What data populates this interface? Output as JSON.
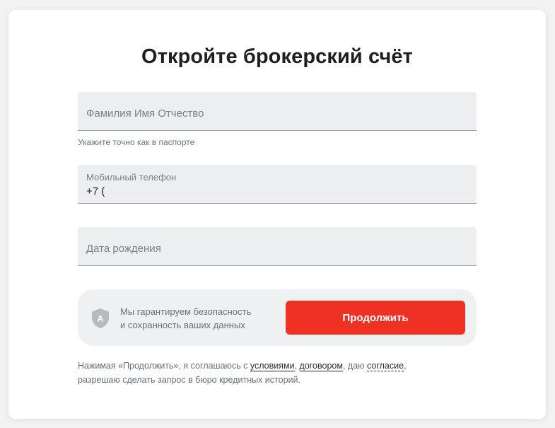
{
  "page": {
    "title": "Откройте брокерский счёт"
  },
  "form": {
    "fullname": {
      "placeholder": "Фамилия Имя Отчество",
      "hint": "Укажите точно как в паспорте"
    },
    "phone": {
      "label": "Мобильный телефон",
      "value": "+7 ("
    },
    "birthdate": {
      "placeholder": "Дата рождения"
    }
  },
  "security": {
    "icon": "shield-icon",
    "icon_letter": "A",
    "line1": "Мы гарантируем безопасность",
    "line2": "и сохранность ваших данных"
  },
  "submit": {
    "label": "Продолжить"
  },
  "legal": {
    "prefix": "Нажимая «Продолжить», я соглашаюсь с ",
    "link_conditions": "условиями",
    "sep1": ", ",
    "link_contract": "договором",
    "sep2": ", даю ",
    "link_consent": "согласие",
    "suffix": ",",
    "line2": "разрешаю сделать запрос в бюро кредитных историй."
  },
  "colors": {
    "accent": "#ef3124",
    "field_bg": "#edeeef",
    "text_primary": "#1f1f1f",
    "text_secondary": "#6a6e73"
  }
}
